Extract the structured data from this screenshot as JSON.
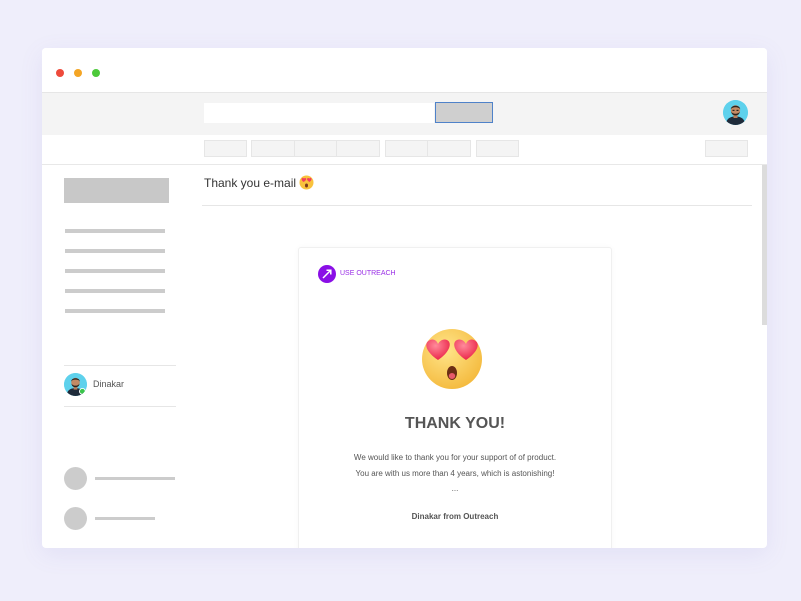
{
  "colors": {
    "page_background": "#efeefb",
    "window_background": "#ffffff",
    "accent_brand": "#8a0fe6",
    "brand_text": "#9a2ee6",
    "traffic_red": "#ee4a3b",
    "traffic_yellow": "#f4a525",
    "traffic_green": "#4cc93a",
    "avatar_background": "#5ed1ec",
    "online_status": "#3ac44a"
  },
  "window": {
    "controls": [
      "close",
      "minimize",
      "maximize"
    ]
  },
  "header": {
    "search_placeholder": "",
    "search_button_label": "",
    "user_avatar": "user-avatar-icon"
  },
  "sidebar": {
    "contact": {
      "name": "Dinakar",
      "status": "online"
    }
  },
  "email": {
    "subject": "Thank you e-mail",
    "subject_emoji": "heart-eyes-emoji",
    "brand_name": "USE OUTREACH",
    "brand_icon": "arrow-up-right-icon",
    "hero_emoji": "heart-eyes-face-emoji",
    "heading": "THANK YOU!",
    "body_lines": [
      "We would like to thank you for your support of of product.",
      "You are with us more than 4 years, which is astonishing!",
      "..."
    ],
    "signature": "Dinakar from Outreach"
  }
}
